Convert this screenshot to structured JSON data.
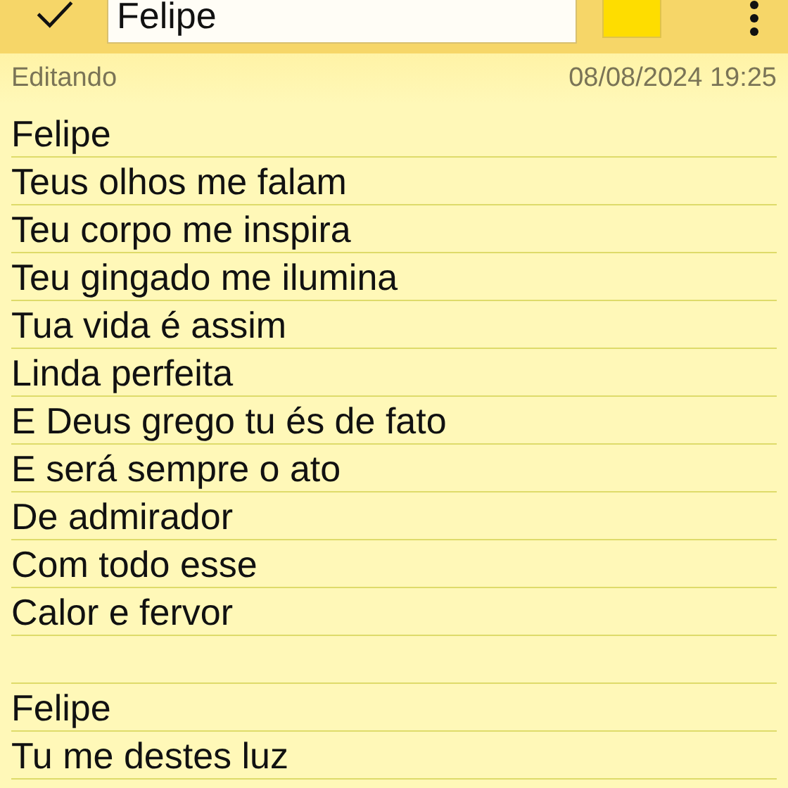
{
  "toolbar": {
    "title": "Felipe"
  },
  "status": {
    "mode": "Editando",
    "timestamp": "08/08/2024 19:25"
  },
  "stanzas": [
    [
      "Felipe",
      "Teus olhos me falam",
      "Teu corpo me inspira",
      "Teu gingado me ilumina",
      "Tua vida é assim",
      "Linda perfeita",
      "E Deus grego tu és de fato",
      "E será sempre o ato",
      "De admirador",
      "Com todo esse",
      "Calor e fervor"
    ],
    [
      "Felipe",
      "Tu me destes luz"
    ]
  ]
}
